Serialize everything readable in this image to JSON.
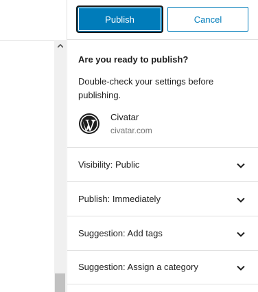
{
  "header": {
    "publish_label": "Publish",
    "cancel_label": "Cancel"
  },
  "intro": {
    "title": "Are you ready to publish?",
    "text": "Double-check your settings before publishing."
  },
  "site": {
    "name": "Civatar",
    "url": "civatar.com",
    "logo_icon": "wordpress-logo-icon"
  },
  "rows": [
    {
      "label": "Visibility: Public"
    },
    {
      "label": "Publish: Immediately"
    },
    {
      "label": "Suggestion: Add tags"
    },
    {
      "label": "Suggestion: Assign a category"
    }
  ],
  "colors": {
    "accent": "#007cba",
    "border": "#e0e0e0",
    "muted_text": "#757575"
  }
}
